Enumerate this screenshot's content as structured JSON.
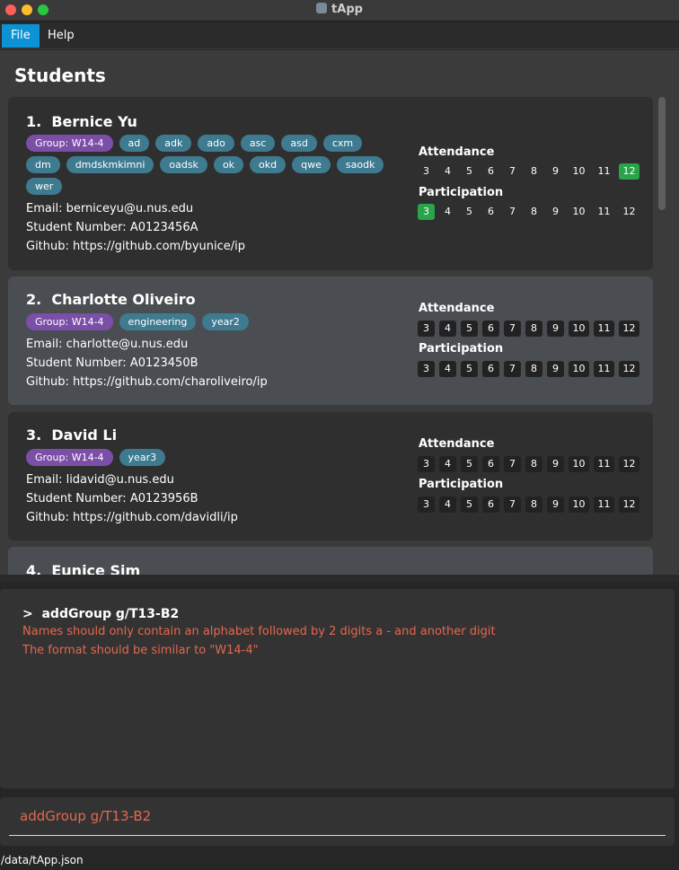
{
  "window": {
    "title": "tApp"
  },
  "menu": {
    "file": "File",
    "help": "Help"
  },
  "panel": {
    "title": "Students"
  },
  "labels": {
    "attendance": "Attendance",
    "participation": "Participation"
  },
  "weeks": [
    "3",
    "4",
    "5",
    "6",
    "7",
    "8",
    "9",
    "10",
    "11",
    "12"
  ],
  "students": [
    {
      "index": "1.",
      "name": "Bernice Yu",
      "tags": [
        "Group: W14-4",
        "ad",
        "adk",
        "ado",
        "asc",
        "asd",
        "cxm",
        "dm",
        "dmdskmkimni",
        "oadsk",
        "ok",
        "okd",
        "qwe",
        "saodk",
        "wer"
      ],
      "email": "Email: berniceyu@u.nus.edu",
      "student_number": "Student Number: A0123456A",
      "github": "Github: https://github.com/byunice/ip",
      "attendance_done": [
        "12"
      ],
      "participation_done": [
        "3"
      ]
    },
    {
      "index": "2.",
      "name": "Charlotte Oliveiro",
      "tags": [
        "Group: W14-4",
        "engineering",
        "year2"
      ],
      "email": "Email: charlotte@u.nus.edu",
      "student_number": "Student Number: A0123450B",
      "github": "Github: https://github.com/charoliveiro/ip",
      "attendance_done": [],
      "participation_done": []
    },
    {
      "index": "3.",
      "name": "David Li",
      "tags": [
        "Group: W14-4",
        "year3"
      ],
      "email": "Email: lidavid@u.nus.edu",
      "student_number": "Student Number: A0123956B",
      "github": "Github: https://github.com/davidli/ip",
      "attendance_done": [],
      "participation_done": []
    },
    {
      "index": "4.",
      "name": "Eunice Sim"
    }
  ],
  "result": {
    "command": "addGroup g/T13-B2",
    "prompt_glyph": ">",
    "lines": [
      "Names should only contain an alphabet followed by 2 digits a - and another digit",
      "The format should be similar to \"W14-4\""
    ]
  },
  "command_box": {
    "value": "addGroup g/T13-B2"
  },
  "status": {
    "path": "/data/tApp.json"
  },
  "colors": {
    "accent": "#0b93d6",
    "group_tag": "#7b4fa8",
    "tag": "#3e7b91",
    "done": "#2aa44b",
    "error": "#e4674e"
  }
}
